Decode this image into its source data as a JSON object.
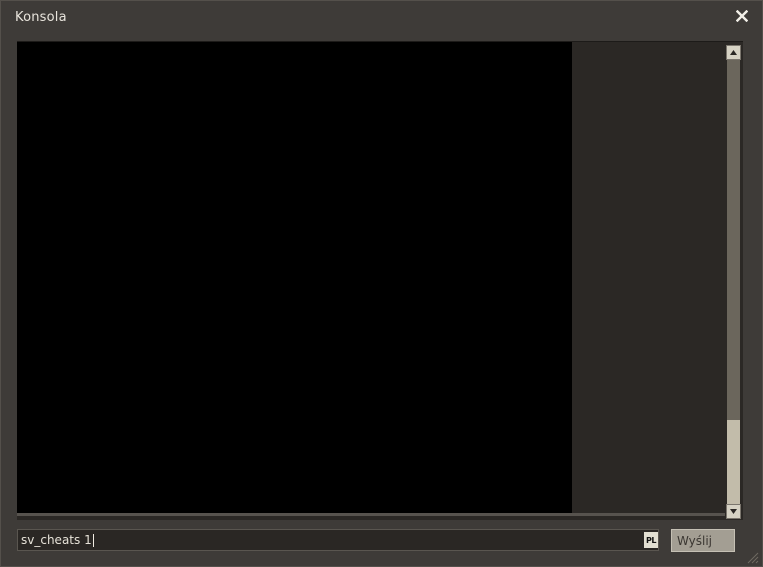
{
  "window": {
    "title": "Konsola"
  },
  "icons": {
    "close": "close-icon",
    "scroll_up": "triangle-up-icon",
    "scroll_down": "triangle-down-icon",
    "resize": "resize-grip-icon"
  },
  "log": {
    "scroll_position": 1.0
  },
  "input": {
    "value": "sv_cheats 1",
    "language": "PL"
  },
  "actions": {
    "send_label": "Wyślij"
  },
  "colors": {
    "window_bg": "#3e3b38",
    "log_bg": "#000000",
    "accent_button": "#a39e93",
    "text": "#e8e4dc"
  }
}
